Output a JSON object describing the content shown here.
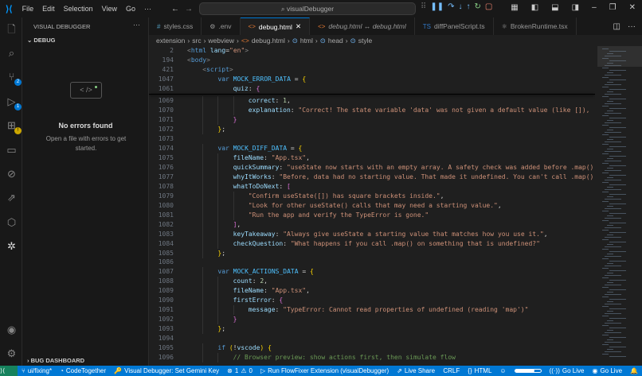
{
  "titlebar": {
    "menu": [
      "File",
      "Edit",
      "Selection",
      "View",
      "Go",
      "···"
    ],
    "search": "visualDebugger"
  },
  "sidebar": {
    "title": "VISUAL DEBUGGER",
    "section": "DEBUG",
    "empty_title": "No errors found",
    "empty_sub": "Open a file with errors to get started.",
    "empty_icon": "< />",
    "bottom_section": "BUG DASHBOARD"
  },
  "activity": {
    "scm_badge": "2",
    "debug_badge": "1"
  },
  "tabs": [
    {
      "label": "styles.css",
      "icon": "#"
    },
    {
      "label": ".env",
      "icon": "⚙"
    },
    {
      "label": "debug.html",
      "icon": "<>",
      "active": true
    },
    {
      "label": "debug.html ↔ debug.html",
      "icon": "<>"
    },
    {
      "label": "diffPanelScript.ts",
      "icon": "TS"
    },
    {
      "label": "BrokenRuntime.tsx",
      "icon": "⚛"
    }
  ],
  "breadcrumb": [
    "extension",
    "src",
    "webview",
    "debug.html",
    "html",
    "head",
    "style"
  ],
  "sticky": [
    {
      "n": "2",
      "i": 0,
      "t": [
        [
          "<",
          "tag"
        ],
        [
          "html",
          "tn"
        ],
        [
          " lang",
          "var"
        ],
        [
          "=",
          "p"
        ],
        [
          "\"en\"",
          "str"
        ],
        [
          ">",
          "tag"
        ]
      ]
    },
    {
      "n": "194",
      "i": 0,
      "t": [
        [
          "<",
          "tag"
        ],
        [
          "body",
          "tn"
        ],
        [
          ">",
          "tag"
        ]
      ]
    },
    {
      "n": "421",
      "i": 1,
      "t": [
        [
          "<",
          "tag"
        ],
        [
          "script",
          "tn"
        ],
        [
          ">",
          "tag"
        ]
      ]
    },
    {
      "n": "1047",
      "i": 2,
      "t": [
        [
          "var ",
          "kw"
        ],
        [
          "MOCK_ERROR_DATA",
          "const"
        ],
        [
          " = ",
          "p"
        ],
        [
          "{",
          "br1"
        ]
      ]
    },
    {
      "n": "1061",
      "i": 3,
      "t": [
        [
          "quiz",
          "var"
        ],
        [
          ": ",
          "p"
        ],
        [
          "{",
          "br2"
        ]
      ]
    }
  ],
  "lines": [
    {
      "n": "1069",
      "i": 4,
      "t": [
        [
          "correct",
          "var"
        ],
        [
          ": ",
          "p"
        ],
        [
          "1",
          "num"
        ],
        [
          ",",
          "p"
        ]
      ]
    },
    {
      "n": "1070",
      "i": 4,
      "t": [
        [
          "explanation",
          "var"
        ],
        [
          ": ",
          "p"
        ],
        [
          "\"Correct! The state variable 'data' was not given a default value (like []),",
          "str"
        ]
      ]
    },
    {
      "n": "1071",
      "i": 3,
      "t": [
        [
          "}",
          "br2"
        ]
      ]
    },
    {
      "n": "1072",
      "i": 2,
      "t": [
        [
          "}",
          "br1"
        ],
        [
          ";",
          "p"
        ]
      ]
    },
    {
      "n": "1073",
      "i": 0,
      "t": []
    },
    {
      "n": "1074",
      "i": 2,
      "t": [
        [
          "var ",
          "kw"
        ],
        [
          "MOCK_DIFF_DATA",
          "const"
        ],
        [
          " = ",
          "p"
        ],
        [
          "{",
          "br1"
        ]
      ]
    },
    {
      "n": "1075",
      "i": 3,
      "t": [
        [
          "fileName",
          "var"
        ],
        [
          ": ",
          "p"
        ],
        [
          "\"App.tsx\"",
          "str"
        ],
        [
          ",",
          "p"
        ]
      ]
    },
    {
      "n": "1076",
      "i": 3,
      "t": [
        [
          "quickSummary",
          "var"
        ],
        [
          ": ",
          "p"
        ],
        [
          "\"useState now starts with an empty array. A safety check was added before .map()",
          "str"
        ]
      ]
    },
    {
      "n": "1077",
      "i": 3,
      "t": [
        [
          "whyItWorks",
          "var"
        ],
        [
          ": ",
          "p"
        ],
        [
          "\"Before, data had no starting value. That made it undefined. You can't call .map()",
          "str"
        ]
      ]
    },
    {
      "n": "1078",
      "i": 3,
      "t": [
        [
          "whatToDoNext",
          "var"
        ],
        [
          ": ",
          "p"
        ],
        [
          "[",
          "br2"
        ]
      ]
    },
    {
      "n": "1079",
      "i": 4,
      "t": [
        [
          "\"Confirm useState([]) has square brackets inside.\"",
          "str"
        ],
        [
          ",",
          "p"
        ]
      ]
    },
    {
      "n": "1080",
      "i": 4,
      "t": [
        [
          "\"Look for other useState() calls that may need a starting value.\"",
          "str"
        ],
        [
          ",",
          "p"
        ]
      ]
    },
    {
      "n": "1081",
      "i": 4,
      "t": [
        [
          "\"Run the app and verify the TypeError is gone.\"",
          "str"
        ]
      ]
    },
    {
      "n": "1082",
      "i": 3,
      "t": [
        [
          "]",
          "br2"
        ],
        [
          ",",
          "p"
        ]
      ]
    },
    {
      "n": "1083",
      "i": 3,
      "t": [
        [
          "keyTakeaway",
          "var"
        ],
        [
          ": ",
          "p"
        ],
        [
          "\"Always give useState a starting value that matches how you use it.\"",
          "str"
        ],
        [
          ",",
          "p"
        ]
      ]
    },
    {
      "n": "1084",
      "i": 3,
      "t": [
        [
          "checkQuestion",
          "var"
        ],
        [
          ": ",
          "p"
        ],
        [
          "\"What happens if you call .map() on something that is undefined?\"",
          "str"
        ]
      ]
    },
    {
      "n": "1085",
      "i": 2,
      "t": [
        [
          "}",
          "br1"
        ],
        [
          ";",
          "p"
        ]
      ]
    },
    {
      "n": "1086",
      "i": 0,
      "t": []
    },
    {
      "n": "1087",
      "i": 2,
      "t": [
        [
          "var ",
          "kw"
        ],
        [
          "MOCK_ACTIONS_DATA",
          "const"
        ],
        [
          " = ",
          "p"
        ],
        [
          "{",
          "br1"
        ]
      ]
    },
    {
      "n": "1088",
      "i": 3,
      "t": [
        [
          "count",
          "var"
        ],
        [
          ": ",
          "p"
        ],
        [
          "2",
          "num"
        ],
        [
          ",",
          "p"
        ]
      ]
    },
    {
      "n": "1089",
      "i": 3,
      "t": [
        [
          "fileName",
          "var"
        ],
        [
          ": ",
          "p"
        ],
        [
          "\"App.tsx\"",
          "str"
        ],
        [
          ",",
          "p"
        ]
      ]
    },
    {
      "n": "1090",
      "i": 3,
      "t": [
        [
          "firstError",
          "var"
        ],
        [
          ": ",
          "p"
        ],
        [
          "{",
          "br2"
        ]
      ]
    },
    {
      "n": "1091",
      "i": 4,
      "t": [
        [
          "message",
          "var"
        ],
        [
          ": ",
          "p"
        ],
        [
          "\"TypeError: Cannot read properties of undefined (reading 'map')\"",
          "str"
        ]
      ]
    },
    {
      "n": "1092",
      "i": 3,
      "t": [
        [
          "}",
          "br2"
        ]
      ]
    },
    {
      "n": "1093",
      "i": 2,
      "t": [
        [
          "}",
          "br1"
        ],
        [
          ";",
          "p"
        ]
      ]
    },
    {
      "n": "1094",
      "i": 0,
      "t": []
    },
    {
      "n": "1095",
      "i": 2,
      "t": [
        [
          "if ",
          "kw"
        ],
        [
          "(",
          "br1"
        ],
        [
          "!",
          "p"
        ],
        [
          "vscode",
          "var"
        ],
        [
          ")",
          "br1"
        ],
        [
          " ",
          "p"
        ],
        [
          "{",
          "br1"
        ]
      ]
    },
    {
      "n": "1096",
      "i": 3,
      "t": [
        [
          "// Browser preview: show actions first, then simulate flow",
          "com"
        ]
      ]
    }
  ],
  "status": {
    "branch": "ui/fixing*",
    "codetogether": "CodeTogether",
    "gemini": "Visual Debugger: Set Gemini Key",
    "errors": "1",
    "warnings": "0",
    "run": "Run FlowFixer Extension (visualDebugger)",
    "liveshare": "Live Share",
    "eol": "CRLF",
    "lang": "HTML",
    "golive1": "Go Live",
    "golive2": "Go Live",
    "progress": 0.75
  }
}
